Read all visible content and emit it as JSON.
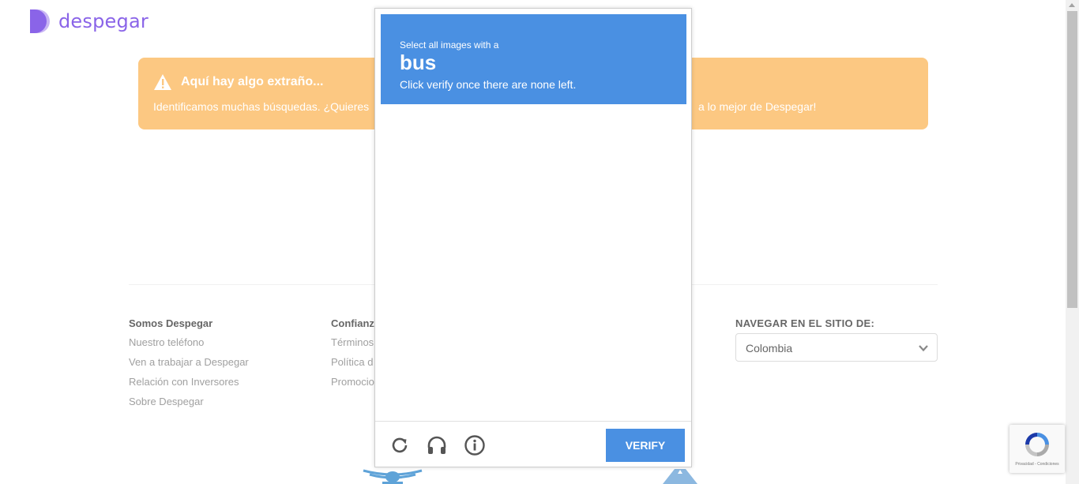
{
  "brand": {
    "name": "despegar",
    "color": "#8a64e8"
  },
  "alert": {
    "title": "Aquí hay algo extraño...",
    "text_left": "Identificamos muchas búsquedas. ¿Quieres",
    "text_right": "a lo mejor de Despegar!",
    "background": "#fcc882"
  },
  "footer": {
    "col1": {
      "heading": "Somos Despegar",
      "links": [
        "Nuestro teléfono",
        "Ven a trabajar a Despegar",
        "Relación con Inversores",
        "Sobre Despegar"
      ]
    },
    "col2": {
      "heading": "Confianz",
      "links": [
        "Términos",
        "Política d",
        "Promocio"
      ]
    },
    "col3": {
      "heading": "NAVEGAR EN EL SITIO DE:",
      "selected_country": "Colombia"
    }
  },
  "captcha": {
    "instruction_line1": "Select all images with a",
    "target": "bus",
    "instruction_line3": "Click verify once there are none left.",
    "verify_label": "VERIFY",
    "accent": "#4a90e2",
    "icons": [
      "reload-icon",
      "headphones-icon",
      "info-icon"
    ]
  },
  "recaptcha_badge": {
    "links": "Privacidad - Condiciones"
  }
}
